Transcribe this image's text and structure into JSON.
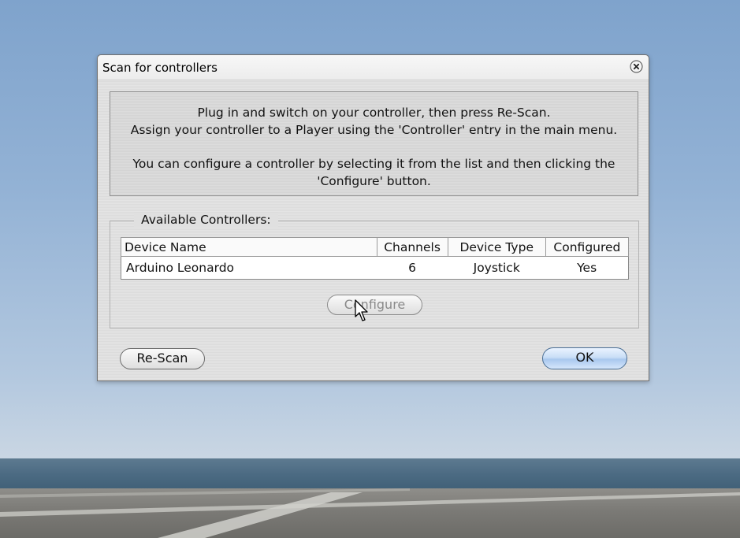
{
  "dialog": {
    "title": "Scan for controllers",
    "close_icon": "close-icon"
  },
  "info": {
    "line1": "Plug in and switch on your controller, then press Re-Scan.",
    "line2": "Assign your controller to a Player using the 'Controller' entry in the main menu.",
    "line3": "You can configure a controller by selecting it from the list and then clicking the",
    "line4": "'Configure' button."
  },
  "controllers": {
    "legend": "Available Controllers:",
    "columns": {
      "name": "Device Name",
      "channels": "Channels",
      "type": "Device Type",
      "configured": "Configured"
    },
    "rows": [
      {
        "name": "Arduino Leonardo",
        "channels": "6",
        "type": "Joystick",
        "configured": "Yes"
      }
    ],
    "configure_label": "Configure"
  },
  "buttons": {
    "rescan_label": "Re-Scan",
    "ok_label": "OK"
  },
  "icons": {
    "close": "close-icon",
    "cursor": "mouse-pointer-icon"
  },
  "colors": {
    "ok_accent": "#a9c8ee",
    "sky": "#93b2d5"
  }
}
